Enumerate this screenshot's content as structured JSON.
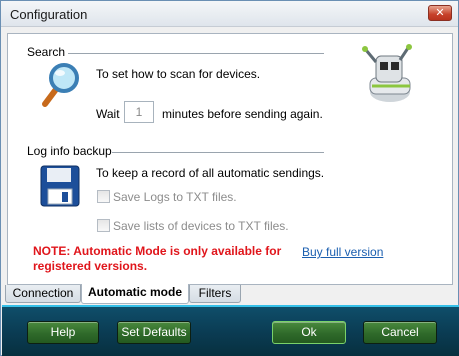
{
  "window": {
    "title": "Configuration",
    "close_glyph": "✕"
  },
  "search": {
    "heading": "Search",
    "description": "To set how to scan for devices.",
    "wait_prefix": "Wait",
    "wait_value": "1",
    "wait_suffix": "minutes before sending again.",
    "icon": "magnifier-icon"
  },
  "log_backup": {
    "heading": "Log info backup",
    "description": "To keep a record of all automatic sendings.",
    "save_logs_label": "Save Logs to TXT files.",
    "save_logs_checked": false,
    "save_devices_label": "Save lists of devices to TXT files.",
    "save_devices_checked": false,
    "icon": "floppy-disk-icon"
  },
  "note": {
    "text": "NOTE: Automatic Mode is only available for registered versions.",
    "color": "#e0151b"
  },
  "buy_link": "Buy full version",
  "mascot_icon": "robot-mascot-icon",
  "tabs": [
    {
      "label": "Connection",
      "active": false
    },
    {
      "label": "Automatic mode",
      "active": true
    },
    {
      "label": "Filters",
      "active": false
    }
  ],
  "buttons": {
    "help": "Help",
    "set_defaults": "Set Defaults",
    "ok": "Ok",
    "cancel": "Cancel"
  },
  "colors": {
    "button_bar": "#0a3b52",
    "bar_accent": "#36c0e8",
    "button_green": "#2f6a2a"
  }
}
